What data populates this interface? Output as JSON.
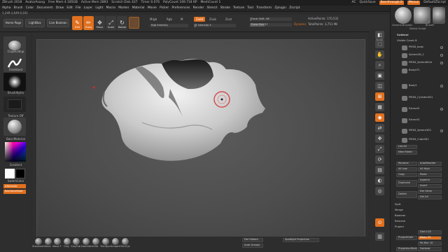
{
  "titlebar": {
    "items": [
      "ZBrush 2018",
      "AvatarAsang",
      "Free Mem 4.185GB",
      "Active Mem 2893",
      "Scratch Disk 437",
      "Timer 0.076",
      "PolyCount 169.734 KP",
      "MeshCount 1"
    ],
    "ac": "AC",
    "quicksave": "QuickSave",
    "seethrough": "See-through 0",
    "menus": "Menus",
    "script": "DefaultZScript"
  },
  "menubar": [
    "Alpha",
    "Brush",
    "Color",
    "Document",
    "Draw",
    "Edit",
    "File",
    "Layer",
    "Light",
    "Macro",
    "Marker",
    "Material",
    "Movie",
    "Picker",
    "Preferences",
    "Render",
    "Stencil",
    "Stroke",
    "Texture",
    "Tool",
    "Transform",
    "Zplugin",
    "Zscript"
  ],
  "info": "1,249.1,649.0,101",
  "toolbar": {
    "home": "Home Page",
    "lightbox": "LightBox",
    "liveboolean": "Live Boolean",
    "tools": [
      {
        "g": "✎",
        "l": "Edit",
        "on": true
      },
      {
        "g": "✏",
        "l": "Draw",
        "on": true
      },
      {
        "g": "✥",
        "l": "Move",
        "on": false
      },
      {
        "g": "⤢",
        "l": "Scale",
        "on": false
      },
      {
        "g": "↻",
        "l": "Rotate",
        "on": false
      }
    ],
    "mrgb": "Mrgb",
    "rgb": "Rgb",
    "m": "M",
    "zadd": "Zadd",
    "zsub": "Zsub",
    "zcut": "Zcut",
    "rgbintensity": "Rgb Intensity",
    "zintensity": "Z Intensity 5",
    "focalshift": "Focal Shift -96",
    "drawsize": "Draw Size 37",
    "dynamic": "Dynamic",
    "activepoints": "ActivePoints: 170,531",
    "totalpoints": "TotalPoints: 3,751 Mil"
  },
  "leftshelf": {
    "brush": "ClayBuildup",
    "stroke": "FreeHand",
    "alpha": "BrushAlpha",
    "texture": "Texture Off",
    "material": "BasicMaterial",
    "gradient": "Gradient",
    "switchcolor": "SwitchColor",
    "alternate": "Alternate",
    "backface": "BackfaceMask"
  },
  "rightshelf": [
    {
      "g": "◧",
      "l": "BPR",
      "on": false
    },
    {
      "g": "⬚",
      "l": "SPix 3",
      "on": false
    },
    {
      "g": "✋",
      "l": "Scroll",
      "on": false
    },
    {
      "g": "⌕",
      "l": "Zoom",
      "on": false
    },
    {
      "g": "▣",
      "l": "Actual",
      "on": false
    },
    {
      "g": "◫",
      "l": "AAHalf",
      "on": false
    },
    {
      "g": "⊞",
      "l": "Persp",
      "on": true
    },
    {
      "g": "▦",
      "l": "Floor",
      "on": false
    },
    {
      "g": "◉",
      "l": "Local",
      "on": true
    },
    {
      "g": "⇄",
      "l": "Sym",
      "on": false
    },
    {
      "g": "✥",
      "l": "Move",
      "on": false
    },
    {
      "g": "⤢",
      "l": "Scale",
      "on": false
    },
    {
      "g": "⟳",
      "l": "Rotate",
      "on": false
    },
    {
      "g": "▤",
      "l": "PolyF",
      "on": false
    },
    {
      "g": "◐",
      "l": "Transp",
      "on": false
    },
    {
      "g": "◎",
      "l": "Ghost",
      "on": false
    },
    {
      "g": "⊙",
      "l": "Solo",
      "on": true
    },
    {
      "g": "▥",
      "l": "Xpose",
      "on": false
    }
  ],
  "panel": {
    "header": [
      "General Brushes",
      "Dentyl Sculpt",
      "BrushP"
    ],
    "subtool": "Subtool",
    "visiblecount": "Visible Count 8",
    "items": [
      "PM3D_body",
      "Sphere3D_1",
      "PM3D_SphereNCol",
      "BodyLP1",
      "Body3",
      "PM3D_Cylinder3D1",
      "Extract5",
      "Extract3",
      "PM3D_Sphere3D1",
      "PM3D_Cube3D1"
    ],
    "buttons": {
      "listall": "List All",
      "newfolder": "New Folder",
      "rename": "Rename",
      "autoreorder": "AutoReorder",
      "alllow": "All Low",
      "allhigh": "All High",
      "copy": "Copy",
      "paste": "Paste",
      "duplicate": "Duplicate",
      "append": "Append",
      "insert": "Insert",
      "delete": "Delete",
      "delother": "Del Other",
      "delall": "Del All",
      "split": "Split",
      "merge": "Merge",
      "boolean": "Boolean",
      "remesh": "Remesh",
      "project": "Project",
      "dist": "Dist 0.02",
      "mean": "Mean 25",
      "projectshell": "ProjectShell",
      "pa": "PA Blur 10",
      "projectbasrelief": "ProjectionShell",
      "farthest": "Farthest"
    }
  },
  "bottom": {
    "brushes": [
      "Standard",
      "Move",
      "Move T",
      "Clay",
      "ClayTub",
      "DamStd",
      "Inflat",
      "TrimDyn",
      "Smooth",
      "TrimCyt"
    ],
    "delhidden": "Del Hidden",
    "autogroups": "Auto Groups",
    "spotlight": "Spotlight Projection"
  }
}
